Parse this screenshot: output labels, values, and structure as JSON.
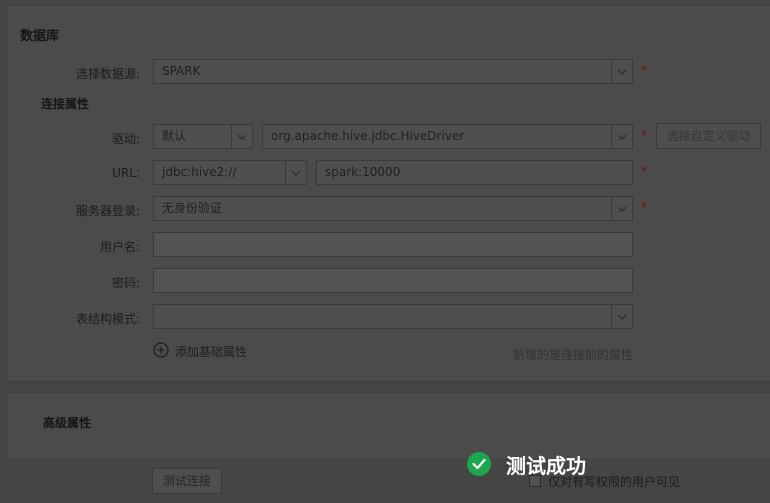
{
  "db_section": {
    "title": "数据库",
    "datasource": {
      "label": "选择数据源:",
      "value": "SPARK"
    },
    "conn_title": "连接属性",
    "driver": {
      "label": "驱动:",
      "mode_value": "默认",
      "class_value": "org.apache.hive.jdbc.HiveDriver",
      "custom_button": "选择自定义驱动"
    },
    "url": {
      "label": "URL:",
      "prefix_value": "jdbc:hive2://",
      "host_value": "spark:10000"
    },
    "server_login": {
      "label": "服务器登录:",
      "value": "无身份验证"
    },
    "username": {
      "label": "用户名:",
      "value": ""
    },
    "password": {
      "label": "密码:",
      "value": ""
    },
    "schema": {
      "label": "表结构模式:",
      "value": ""
    },
    "add_property": "添加基础属性",
    "add_hint": "新增的是连接前的属性",
    "required_mark": "*"
  },
  "advanced": {
    "title": "高级属性"
  },
  "footer": {
    "test_button": "测试连接",
    "visibility_checkbox": "仅对有写权限的用户可见"
  },
  "toast": {
    "message": "测试成功",
    "icon": "check-circle-icon",
    "color": "#1ea54f"
  }
}
